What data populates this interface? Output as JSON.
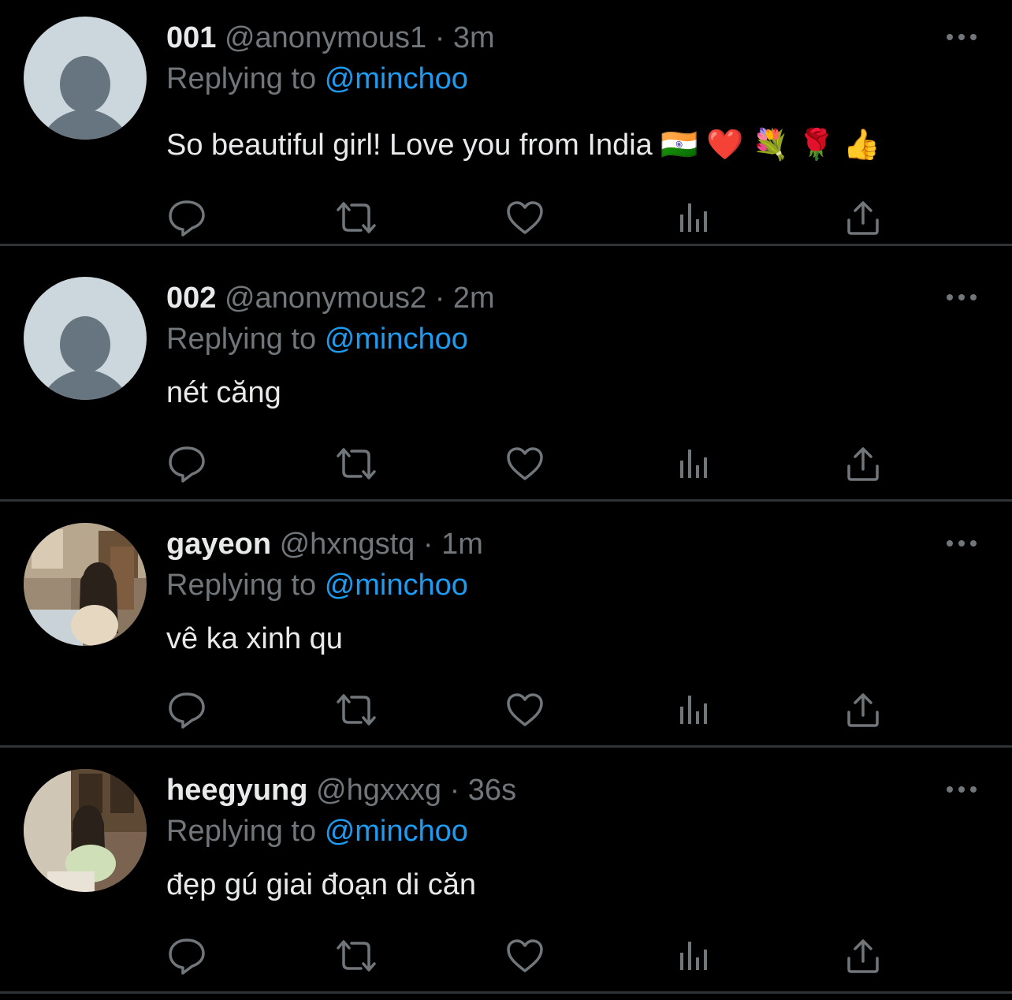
{
  "theme": {
    "background": "#000000",
    "divider": "#2f3336",
    "primary_text": "#e7e9ea",
    "secondary_text": "#71767b",
    "accent": "#1d9bf0",
    "icon": "#71767b"
  },
  "tweets": [
    {
      "display_name": "001",
      "handle": "@anonymous1",
      "separator": "·",
      "time": "3m",
      "replying_label": "Replying to",
      "reply_to": "@minchoo",
      "text": "So beautiful girl! Love you from India 🇮🇳 ❤️ 💐 🌹 👍",
      "avatar": "default-avatar-icon"
    },
    {
      "display_name": "002",
      "handle": "@anonymous2",
      "separator": "·",
      "time": "2m",
      "replying_label": "Replying to",
      "reply_to": "@minchoo",
      "text": "nét căng",
      "avatar": "default-avatar-icon"
    },
    {
      "display_name": "gayeon",
      "handle": "@hxngstq",
      "separator": "·",
      "time": "1m",
      "replying_label": "Replying to",
      "reply_to": "@minchoo",
      "text": "vê ka xinh qu",
      "avatar": "photo-avatar"
    },
    {
      "display_name": "heegyung",
      "handle": "@hgxxxg",
      "separator": "·",
      "time": "36s",
      "replying_label": "Replying to",
      "reply_to": "@minchoo",
      "text": "đẹp gú giai đoạn di căn",
      "avatar": "photo-avatar"
    }
  ],
  "action_icons": [
    "reply-icon",
    "retweet-icon",
    "like-icon",
    "views-icon",
    "share-icon"
  ],
  "more_icon": "more-options-icon"
}
